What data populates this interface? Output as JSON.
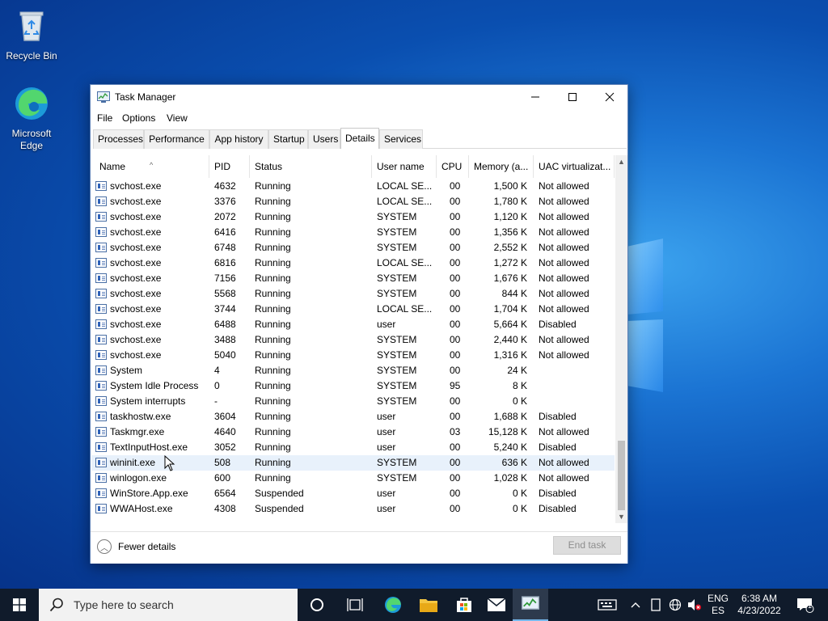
{
  "desktop": {
    "icons": [
      {
        "label": "Recycle Bin"
      },
      {
        "label": "Microsoft Edge"
      }
    ]
  },
  "window": {
    "title": "Task Manager",
    "menu": [
      "File",
      "Options",
      "View"
    ],
    "tabs": [
      "Processes",
      "Performance",
      "App history",
      "Startup",
      "Users",
      "Details",
      "Services"
    ],
    "active_tab": "Details",
    "columns": [
      "Name",
      "PID",
      "Status",
      "User name",
      "CPU",
      "Memory (a...",
      "UAC virtualizat..."
    ],
    "rows": [
      {
        "name": "svchost.exe",
        "pid": "4632",
        "status": "Running",
        "user": "LOCAL SE...",
        "cpu": "00",
        "mem": "1,500 K",
        "uac": "Not allowed"
      },
      {
        "name": "svchost.exe",
        "pid": "3376",
        "status": "Running",
        "user": "LOCAL SE...",
        "cpu": "00",
        "mem": "1,780 K",
        "uac": "Not allowed"
      },
      {
        "name": "svchost.exe",
        "pid": "2072",
        "status": "Running",
        "user": "SYSTEM",
        "cpu": "00",
        "mem": "1,120 K",
        "uac": "Not allowed"
      },
      {
        "name": "svchost.exe",
        "pid": "6416",
        "status": "Running",
        "user": "SYSTEM",
        "cpu": "00",
        "mem": "1,356 K",
        "uac": "Not allowed"
      },
      {
        "name": "svchost.exe",
        "pid": "6748",
        "status": "Running",
        "user": "SYSTEM",
        "cpu": "00",
        "mem": "2,552 K",
        "uac": "Not allowed"
      },
      {
        "name": "svchost.exe",
        "pid": "6816",
        "status": "Running",
        "user": "LOCAL SE...",
        "cpu": "00",
        "mem": "1,272 K",
        "uac": "Not allowed"
      },
      {
        "name": "svchost.exe",
        "pid": "7156",
        "status": "Running",
        "user": "SYSTEM",
        "cpu": "00",
        "mem": "1,676 K",
        "uac": "Not allowed"
      },
      {
        "name": "svchost.exe",
        "pid": "5568",
        "status": "Running",
        "user": "SYSTEM",
        "cpu": "00",
        "mem": "844 K",
        "uac": "Not allowed"
      },
      {
        "name": "svchost.exe",
        "pid": "3744",
        "status": "Running",
        "user": "LOCAL SE...",
        "cpu": "00",
        "mem": "1,704 K",
        "uac": "Not allowed"
      },
      {
        "name": "svchost.exe",
        "pid": "6488",
        "status": "Running",
        "user": "user",
        "cpu": "00",
        "mem": "5,664 K",
        "uac": "Disabled"
      },
      {
        "name": "svchost.exe",
        "pid": "3488",
        "status": "Running",
        "user": "SYSTEM",
        "cpu": "00",
        "mem": "2,440 K",
        "uac": "Not allowed"
      },
      {
        "name": "svchost.exe",
        "pid": "5040",
        "status": "Running",
        "user": "SYSTEM",
        "cpu": "00",
        "mem": "1,316 K",
        "uac": "Not allowed"
      },
      {
        "name": "System",
        "pid": "4",
        "status": "Running",
        "user": "SYSTEM",
        "cpu": "00",
        "mem": "24 K",
        "uac": ""
      },
      {
        "name": "System Idle Process",
        "pid": "0",
        "status": "Running",
        "user": "SYSTEM",
        "cpu": "95",
        "mem": "8 K",
        "uac": ""
      },
      {
        "name": "System interrupts",
        "pid": "-",
        "status": "Running",
        "user": "SYSTEM",
        "cpu": "00",
        "mem": "0 K",
        "uac": ""
      },
      {
        "name": "taskhostw.exe",
        "pid": "3604",
        "status": "Running",
        "user": "user",
        "cpu": "00",
        "mem": "1,688 K",
        "uac": "Disabled"
      },
      {
        "name": "Taskmgr.exe",
        "pid": "4640",
        "status": "Running",
        "user": "user",
        "cpu": "03",
        "mem": "15,128 K",
        "uac": "Not allowed"
      },
      {
        "name": "TextInputHost.exe",
        "pid": "3052",
        "status": "Running",
        "user": "user",
        "cpu": "00",
        "mem": "5,240 K",
        "uac": "Disabled"
      },
      {
        "name": "wininit.exe",
        "pid": "508",
        "status": "Running",
        "user": "SYSTEM",
        "cpu": "00",
        "mem": "636 K",
        "uac": "Not allowed"
      },
      {
        "name": "winlogon.exe",
        "pid": "600",
        "status": "Running",
        "user": "SYSTEM",
        "cpu": "00",
        "mem": "1,028 K",
        "uac": "Not allowed"
      },
      {
        "name": "WinStore.App.exe",
        "pid": "6564",
        "status": "Suspended",
        "user": "user",
        "cpu": "00",
        "mem": "0 K",
        "uac": "Disabled"
      },
      {
        "name": "WWAHost.exe",
        "pid": "4308",
        "status": "Suspended",
        "user": "user",
        "cpu": "00",
        "mem": "0 K",
        "uac": "Disabled"
      }
    ],
    "highlighted_row": "wininit.exe",
    "fewer_details": "Fewer details",
    "end_task": "End task"
  },
  "taskbar": {
    "search_placeholder": "Type here to search",
    "lang_top": "ENG",
    "lang_bottom": "ES",
    "time": "6:38 AM",
    "date": "4/23/2022",
    "notification_count": "1",
    "colors": {
      "bar": "#101b2b",
      "accent": "#0078d7"
    }
  }
}
